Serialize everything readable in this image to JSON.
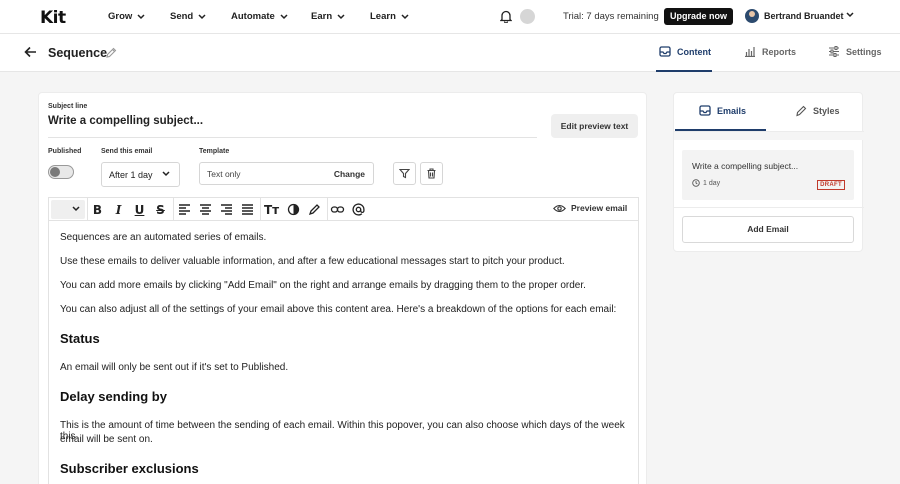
{
  "nav": {
    "logo": "Kit",
    "items": [
      {
        "label": "Grow"
      },
      {
        "label": "Send"
      },
      {
        "label": "Automate"
      },
      {
        "label": "Earn"
      },
      {
        "label": "Learn"
      }
    ],
    "trial_text": "Trial: 7 days remaining",
    "upgrade_label": "Upgrade now",
    "user_name": "Bertrand Bruandet",
    "icons": [
      "bell-icon",
      "status-circle-icon",
      "chevron-down-icon"
    ]
  },
  "subbar": {
    "title": "Sequence",
    "tabs": [
      {
        "label": "Content",
        "active": true,
        "icon": "envelope-icon"
      },
      {
        "label": "Reports",
        "active": false,
        "icon": "bar-chart-icon"
      },
      {
        "label": "Settings",
        "active": false,
        "icon": "sliders-icon"
      }
    ]
  },
  "editor": {
    "subject_label": "Subject line",
    "subject_value": "Write a compelling subject...",
    "edit_preview_label": "Edit preview text",
    "published_label": "Published",
    "published_state": false,
    "send_label": "Send this email",
    "send_value": "After 1 day",
    "template_label": "Template",
    "template_value": "Text only",
    "template_change": "Change",
    "preview_label": "Preview email",
    "toolbar_icons": [
      "bold-icon",
      "italic-icon",
      "underline-icon",
      "strikethrough-icon",
      "align-left-icon",
      "align-center-icon",
      "align-right-icon",
      "align-justify-icon",
      "text-size-icon",
      "color-fill-icon",
      "highlight-icon",
      "link-icon",
      "mention-icon"
    ],
    "body": {
      "p1": "Sequences are an automated series of emails.",
      "p2": "Use these emails to deliver valuable information, and after a few educational messages start to pitch your product.",
      "p3": "You can add more emails by clicking \"Add Email\" on the right and arrange emails by dragging them to the proper order.",
      "p4": "You can also adjust all of the settings of your email above this content area. Here's a breakdown of the options for each email:",
      "h1": "Status",
      "p5": "An email will only be sent out if it's set to Published.",
      "h2": "Delay sending by",
      "p6a": "This is the amount of time between the sending of each email. Within this popover, you can also choose which days of the week this",
      "p6b": "email will be sent on.",
      "h3": "Subscriber exclusions"
    }
  },
  "side": {
    "tabs": [
      {
        "label": "Emails",
        "active": true,
        "icon": "envelope-icon"
      },
      {
        "label": "Styles",
        "active": false,
        "icon": "brush-icon"
      }
    ],
    "email_item": {
      "subject": "Write a compelling subject...",
      "delay": "1 day",
      "status": "DRAFT"
    },
    "add_email_label": "Add Email"
  },
  "colors": {
    "accent": "#1f3d6b",
    "draft": "#c0392b",
    "upgrade_bg": "#111111"
  }
}
